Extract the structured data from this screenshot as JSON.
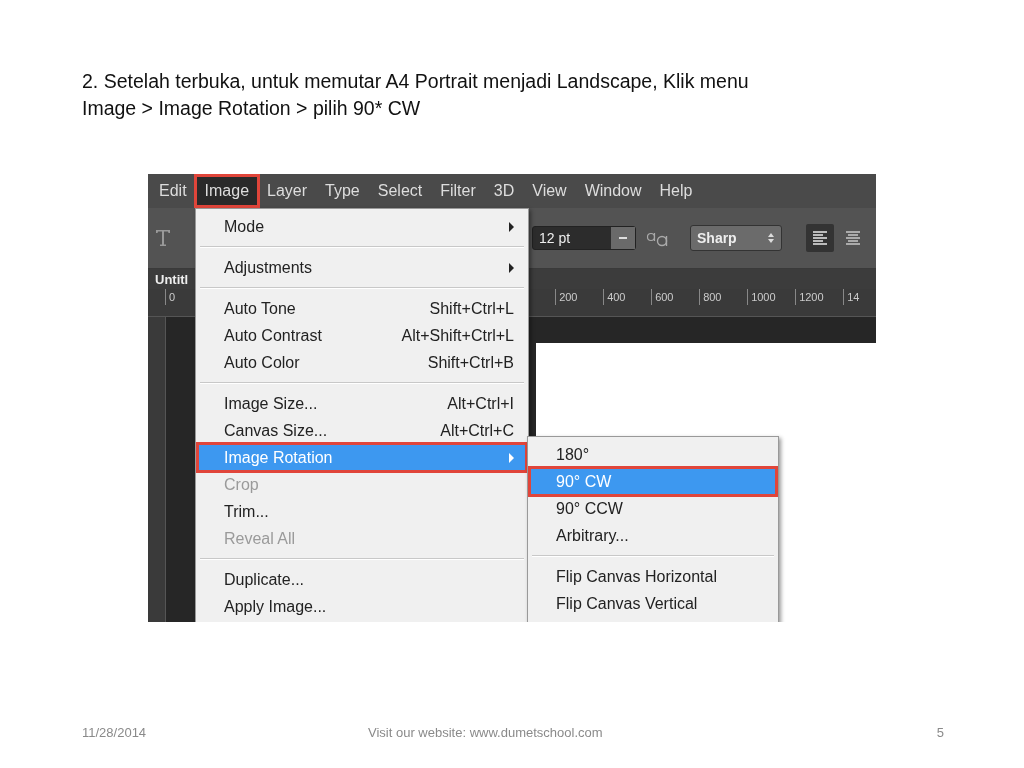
{
  "slide": {
    "heading": "2. Setelah terbuka, untuk memutar A4 Portrait menjadi Landscape, Klik menu\nImage > Image Rotation > pilih 90* CW",
    "footer": {
      "date": "11/28/2014",
      "text": "Visit our website: www.dumetschool.com",
      "page": "5"
    }
  },
  "screenshot": {
    "menubar": [
      {
        "label": "Edit",
        "selected": false,
        "annotated": false
      },
      {
        "label": "Image",
        "selected": true,
        "annotated": true
      },
      {
        "label": "Layer",
        "selected": false,
        "annotated": false
      },
      {
        "label": "Type",
        "selected": false,
        "annotated": false
      },
      {
        "label": "Select",
        "selected": false,
        "annotated": false
      },
      {
        "label": "Filter",
        "selected": false,
        "annotated": false
      },
      {
        "label": "3D",
        "selected": false,
        "annotated": false
      },
      {
        "label": "View",
        "selected": false,
        "annotated": false
      },
      {
        "label": "Window",
        "selected": false,
        "annotated": false
      },
      {
        "label": "Help",
        "selected": false,
        "annotated": false
      }
    ],
    "options_bar": {
      "font_size": "12 pt",
      "antialias": "Sharp"
    },
    "document_tab": "Untitl",
    "ruler_labels": [
      "0",
      "200",
      "400",
      "600",
      "800",
      "1000",
      "1200",
      "14"
    ],
    "image_menu": [
      {
        "items": [
          {
            "label": "Mode",
            "submenu": true,
            "disabled": false,
            "selected": false,
            "annotated": false
          }
        ]
      },
      {
        "items": [
          {
            "label": "Adjustments",
            "submenu": true,
            "disabled": false,
            "selected": false,
            "annotated": false
          }
        ]
      },
      {
        "items": [
          {
            "label": "Auto Tone",
            "shortcut": "Shift+Ctrl+L",
            "submenu": false,
            "disabled": false,
            "selected": false,
            "annotated": false
          },
          {
            "label": "Auto Contrast",
            "shortcut": "Alt+Shift+Ctrl+L",
            "submenu": false,
            "disabled": false,
            "selected": false,
            "annotated": false
          },
          {
            "label": "Auto Color",
            "shortcut": "Shift+Ctrl+B",
            "submenu": false,
            "disabled": false,
            "selected": false,
            "annotated": false
          }
        ]
      },
      {
        "items": [
          {
            "label": "Image Size...",
            "shortcut": "Alt+Ctrl+I",
            "submenu": false,
            "disabled": false,
            "selected": false,
            "annotated": false
          },
          {
            "label": "Canvas Size...",
            "shortcut": "Alt+Ctrl+C",
            "submenu": false,
            "disabled": false,
            "selected": false,
            "annotated": false
          },
          {
            "label": "Image Rotation",
            "submenu": true,
            "disabled": false,
            "selected": true,
            "annotated": true
          },
          {
            "label": "Crop",
            "submenu": false,
            "disabled": true,
            "selected": false,
            "annotated": false
          },
          {
            "label": "Trim...",
            "submenu": false,
            "disabled": false,
            "selected": false,
            "annotated": false
          },
          {
            "label": "Reveal All",
            "submenu": false,
            "disabled": true,
            "selected": false,
            "annotated": false
          }
        ]
      },
      {
        "items": [
          {
            "label": "Duplicate...",
            "submenu": false,
            "disabled": false,
            "selected": false,
            "annotated": false
          },
          {
            "label": "Apply Image...",
            "submenu": false,
            "disabled": false,
            "selected": false,
            "annotated": false
          }
        ]
      }
    ],
    "rotation_submenu": [
      {
        "items": [
          {
            "label": "180°",
            "submenu": false,
            "disabled": false,
            "selected": false,
            "annotated": false
          },
          {
            "label": "90° CW",
            "submenu": false,
            "disabled": false,
            "selected": true,
            "annotated": true
          },
          {
            "label": "90° CCW",
            "submenu": false,
            "disabled": false,
            "selected": false,
            "annotated": false
          },
          {
            "label": "Arbitrary...",
            "submenu": false,
            "disabled": false,
            "selected": false,
            "annotated": false
          }
        ]
      },
      {
        "items": [
          {
            "label": "Flip Canvas Horizontal",
            "submenu": false,
            "disabled": false,
            "selected": false,
            "annotated": false
          },
          {
            "label": "Flip Canvas Vertical",
            "submenu": false,
            "disabled": false,
            "selected": false,
            "annotated": false
          }
        ]
      }
    ]
  }
}
